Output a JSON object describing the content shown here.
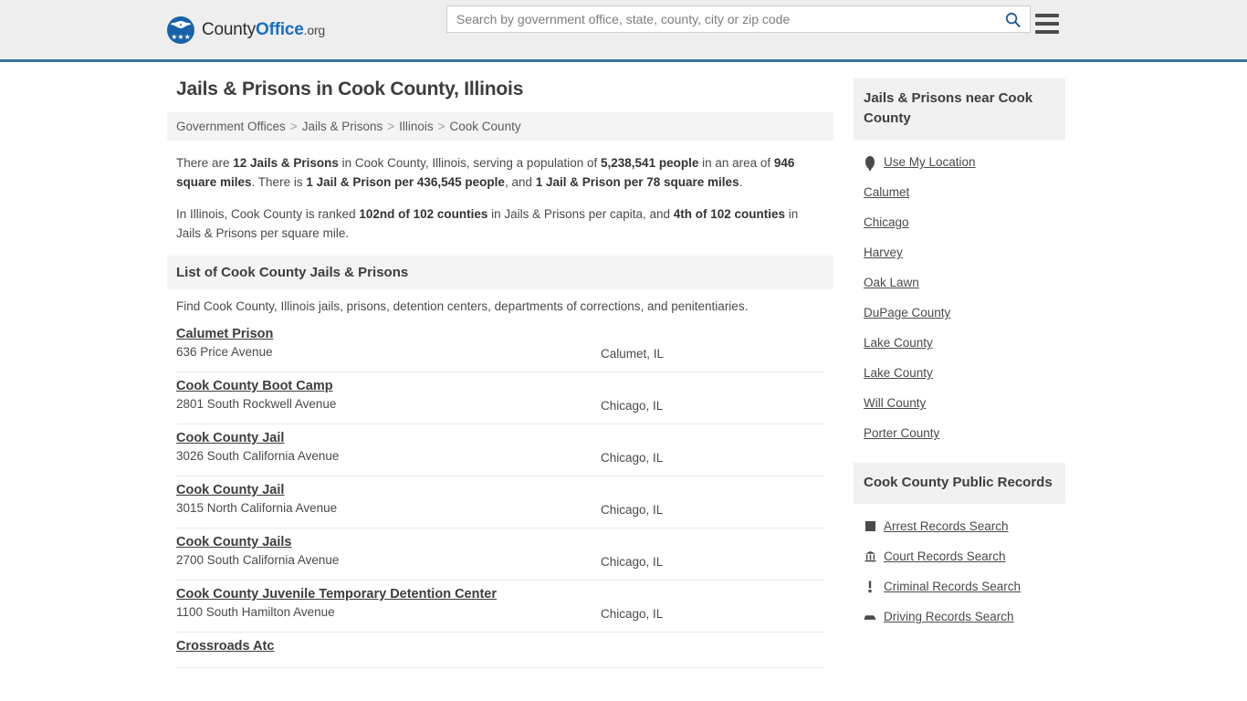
{
  "header": {
    "brand": {
      "part1": "County",
      "part2": "Office",
      "part3": ".org",
      "stars": "★★★"
    },
    "search": {
      "placeholder": "Search by government office, state, county, city or zip code",
      "value": "",
      "search_icon": "search-icon"
    },
    "menu_icon": "hamburger-menu-icon"
  },
  "main": {
    "title": "Jails & Prisons in Cook County, Illinois",
    "breadcrumb": [
      "Government Offices",
      "Jails & Prisons",
      "Illinois",
      "Cook County"
    ],
    "breadcrumb_separator": ">",
    "stats": {
      "p1_a": "There are ",
      "p1_b1": "12 Jails & Prisons",
      "p1_c": " in Cook County, Illinois, serving a population of ",
      "p1_b2": "5,238,541 people",
      "p1_d": " in an area of ",
      "p1_b3": "946 square miles",
      "p1_e": ". There is ",
      "p1_b4": "1 Jail & Prison per 436,545 people",
      "p1_f": ", and ",
      "p1_b5": "1 Jail & Prison per 78 square miles",
      "p1_g": ".",
      "p2_a": "In Illinois, Cook County is ranked ",
      "p2_b1": "102nd of 102 counties",
      "p2_c": " in Jails & Prisons per capita, and ",
      "p2_b2": "4th of 102 counties",
      "p2_d": " in Jails & Prisons per square mile."
    },
    "list_section_title": "List of Cook County Jails & Prisons",
    "list_section_desc": "Find Cook County, Illinois jails, prisons, detention centers, departments of corrections, and penitentiaries.",
    "listings": [
      {
        "name": "Calumet Prison",
        "address": "636 Price Avenue",
        "city": "Calumet, IL"
      },
      {
        "name": "Cook County Boot Camp",
        "address": "2801 South Rockwell Avenue",
        "city": "Chicago, IL"
      },
      {
        "name": "Cook County Jail",
        "address": "3026 South California Avenue",
        "city": "Chicago, IL"
      },
      {
        "name": "Cook County Jail",
        "address": "3015 North California Avenue",
        "city": "Chicago, IL"
      },
      {
        "name": "Cook County Jails",
        "address": "2700 South California Avenue",
        "city": "Chicago, IL"
      },
      {
        "name": "Cook County Juvenile Temporary Detention Center",
        "address": "1100 South Hamilton Avenue",
        "city": "Chicago, IL"
      },
      {
        "name": "Crossroads Atc",
        "address": "",
        "city": ""
      }
    ]
  },
  "sidebar": {
    "nearby": {
      "title": "Jails & Prisons near Cook County",
      "items": [
        {
          "label": "Use My Location",
          "icon": "map-pin-icon"
        },
        {
          "label": "Calumet",
          "icon": ""
        },
        {
          "label": "Chicago",
          "icon": ""
        },
        {
          "label": "Harvey",
          "icon": ""
        },
        {
          "label": "Oak Lawn",
          "icon": ""
        },
        {
          "label": "DuPage County",
          "icon": ""
        },
        {
          "label": "Lake County",
          "icon": ""
        },
        {
          "label": "Lake County",
          "icon": ""
        },
        {
          "label": "Will County",
          "icon": ""
        },
        {
          "label": "Porter County",
          "icon": ""
        }
      ]
    },
    "public_records": {
      "title": "Cook County Public Records",
      "items": [
        {
          "label": "Arrest Records Search",
          "icon": "square-icon"
        },
        {
          "label": "Court Records Search",
          "icon": "courthouse-icon"
        },
        {
          "label": "Criminal Records Search",
          "icon": "exclamation-icon"
        },
        {
          "label": "Driving Records Search",
          "icon": "car-icon"
        }
      ]
    }
  },
  "colors": {
    "header_bg": "#eeeeee",
    "accent_blue": "#3a73a8",
    "brand_blue": "#1a6fc4",
    "panel_gray": "#f4f4f4",
    "text": "#4a4a4a"
  }
}
